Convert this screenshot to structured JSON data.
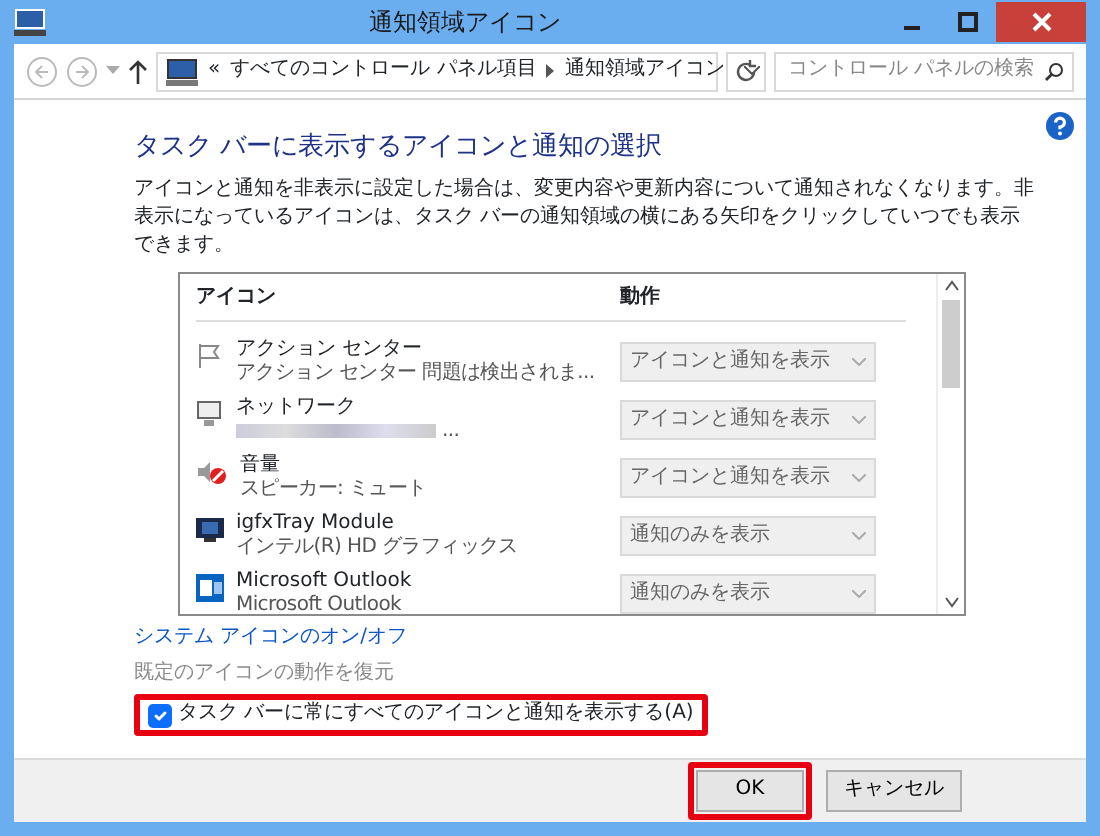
{
  "window": {
    "title": "通知領域アイコン"
  },
  "address_bar": {
    "prefix": "«",
    "crumbs": [
      "すべてのコントロール パネル項目",
      "通知領域アイコン"
    ]
  },
  "search": {
    "placeholder": "コントロール パネルの検索"
  },
  "heading": "タスク バーに表示するアイコンと通知の選択",
  "description": "アイコンと通知を非表示に設定した場合は、変更内容や更新内容について通知されなくなります。非表示になっているアイコンは、タスク バーの通知領域の横にある矢印をクリックしていつでも表示できます。",
  "table": {
    "columns": [
      "アイコン",
      "動作"
    ],
    "rows": [
      {
        "name": "アクション センター",
        "detail": "アクション センター  問題は検出されま...",
        "action": "アイコンと通知を表示",
        "disabled": true
      },
      {
        "name": "ネットワーク",
        "detail": "...",
        "blurred": true,
        "action": "アイコンと通知を表示",
        "disabled": true
      },
      {
        "name": "音量",
        "detail": "スピーカー: ミュート",
        "action": "アイコンと通知を表示",
        "disabled": true
      },
      {
        "name": "igfxTray Module",
        "detail": "インテル(R) HD グラフィックス",
        "action": "通知のみを表示",
        "disabled": true
      },
      {
        "name": "Microsoft Outlook",
        "detail": "Microsoft Outlook",
        "action": "通知のみを表示",
        "disabled": true
      }
    ]
  },
  "links": [
    {
      "text": "システム アイコンのオン/オフ",
      "disabled": false
    },
    {
      "text": "既定のアイコンの動作を復元",
      "disabled": true
    }
  ],
  "checkbox": {
    "label": "タスク バーに常にすべてのアイコンと通知を表示する(A)",
    "checked": true,
    "highlighted": true
  },
  "buttons": [
    {
      "label": "OK",
      "highlighted": true
    },
    {
      "label": "キャンセル",
      "highlighted": false
    }
  ]
}
